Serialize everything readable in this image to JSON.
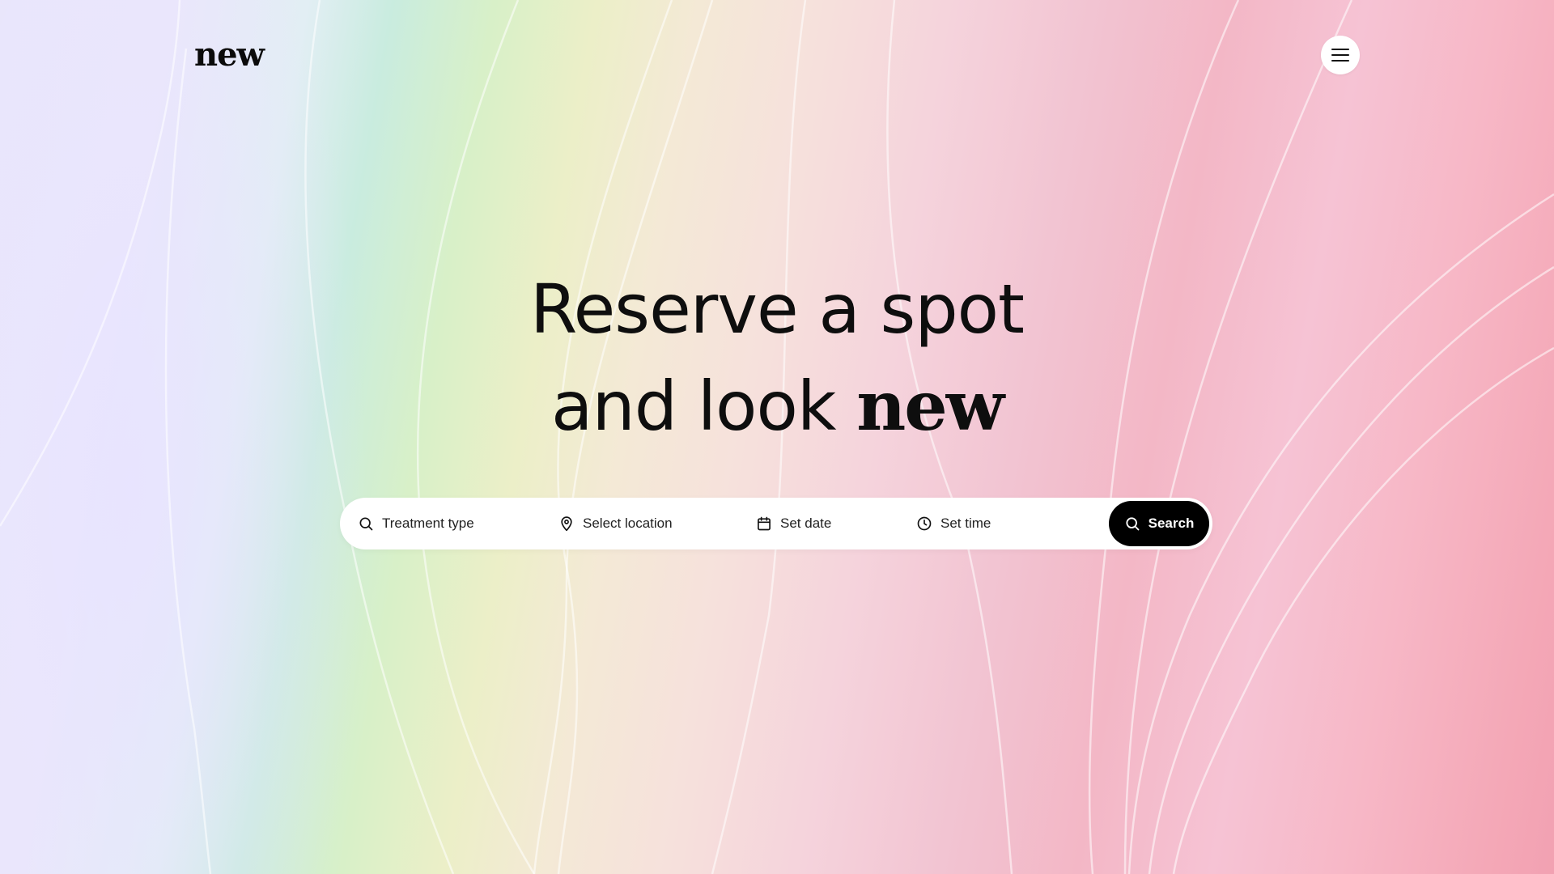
{
  "header": {
    "logo": "new",
    "menu_icon": "menu-icon"
  },
  "hero": {
    "line1": "Reserve a spot",
    "line2_prefix": "and look ",
    "line2_accent": "new"
  },
  "search": {
    "treatment": {
      "label": "Treatment type",
      "icon": "search-icon"
    },
    "location": {
      "label": "Select location",
      "icon": "location-pin-icon"
    },
    "date": {
      "label": "Set date",
      "icon": "calendar-icon"
    },
    "time": {
      "label": "Set time",
      "icon": "clock-icon"
    },
    "button": {
      "label": "Search",
      "icon": "search-icon"
    }
  },
  "colors": {
    "accent": "#000000",
    "background_lavender": "#e9e6fb",
    "background_mint": "#c9ecdf",
    "background_pink": "#f3b7c6"
  }
}
